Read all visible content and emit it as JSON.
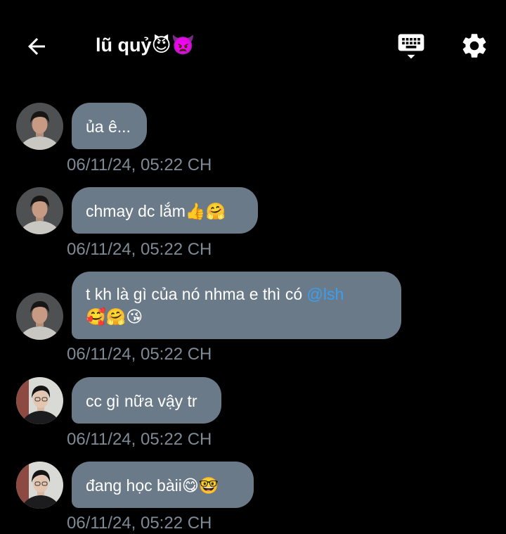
{
  "header": {
    "title": "lũ quỷ😈👿",
    "back_icon": "arrow-left-icon",
    "keyboard_icon": "keyboard-icon",
    "settings_icon": "gear-icon"
  },
  "colors": {
    "background": "#000000",
    "bubble": "#6b7a88",
    "timestamp": "#7e8a96",
    "mention": "#3a9ff0"
  },
  "messages": [
    {
      "text": "ủa ê...",
      "time": "06/11/24, 05:22 CH"
    },
    {
      "text": "chmay dc lắm👍🤗",
      "time": "06/11/24, 05:22 CH"
    },
    {
      "text_before": "t kh là gì của nó nhma e thì có ",
      "mention": "@lsh",
      "text_after": "🥰🤗😘",
      "time": "06/11/24, 05:22 CH"
    },
    {
      "text": "cc gì nữa vậy tr",
      "time": "06/11/24, 05:22 CH"
    },
    {
      "text": "đang học bàii😋🤓",
      "time": "06/11/24, 05:22 CH"
    }
  ]
}
